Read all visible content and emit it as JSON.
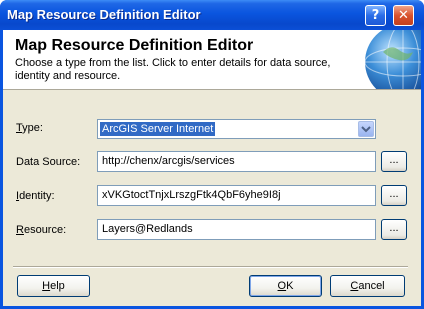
{
  "window": {
    "title": "Map Resource Definition Editor",
    "help_glyph": "?",
    "close_glyph": "✕"
  },
  "banner": {
    "title": "Map Resource Definition Editor",
    "description": "Choose a type from the list. Click to enter details for data source, identity and resource."
  },
  "form": {
    "type_label_key": "T",
    "type_label_rest": "ype:",
    "type_value": "ArcGIS Server Internet",
    "datasource_label": "Data Source:",
    "datasource_value": "http://chenx/arcgis/services",
    "identity_label_key": "I",
    "identity_label_rest": "dentity:",
    "identity_value": "xVKGtoctTnjxLrszgFtk4QbF6yhe9I8j",
    "resource_label_key": "R",
    "resource_label_rest": "esource:",
    "resource_value": "Layers@Redlands",
    "ellipsis_label": "..."
  },
  "buttons": {
    "help_key": "H",
    "help_rest": "elp",
    "ok_key": "O",
    "ok_rest": "K",
    "cancel_key": "C",
    "cancel_rest": "ancel"
  },
  "icons": {
    "banner_graphic": "globe-icon",
    "dropdown": "chevron-down-icon"
  },
  "colors": {
    "titlebar": "#0a55df",
    "selection": "#316ac5",
    "dialog_bg": "#ece9d8"
  }
}
